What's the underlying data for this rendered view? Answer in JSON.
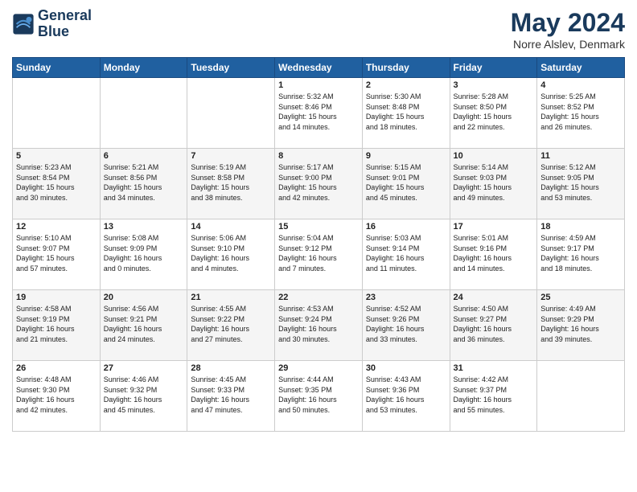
{
  "logo": {
    "line1": "General",
    "line2": "Blue"
  },
  "title": "May 2024",
  "subtitle": "Norre Alslev, Denmark",
  "weekdays": [
    "Sunday",
    "Monday",
    "Tuesday",
    "Wednesday",
    "Thursday",
    "Friday",
    "Saturday"
  ],
  "weeks": [
    [
      {
        "day": "",
        "info": ""
      },
      {
        "day": "",
        "info": ""
      },
      {
        "day": "",
        "info": ""
      },
      {
        "day": "1",
        "info": "Sunrise: 5:32 AM\nSunset: 8:46 PM\nDaylight: 15 hours\nand 14 minutes."
      },
      {
        "day": "2",
        "info": "Sunrise: 5:30 AM\nSunset: 8:48 PM\nDaylight: 15 hours\nand 18 minutes."
      },
      {
        "day": "3",
        "info": "Sunrise: 5:28 AM\nSunset: 8:50 PM\nDaylight: 15 hours\nand 22 minutes."
      },
      {
        "day": "4",
        "info": "Sunrise: 5:25 AM\nSunset: 8:52 PM\nDaylight: 15 hours\nand 26 minutes."
      }
    ],
    [
      {
        "day": "5",
        "info": "Sunrise: 5:23 AM\nSunset: 8:54 PM\nDaylight: 15 hours\nand 30 minutes."
      },
      {
        "day": "6",
        "info": "Sunrise: 5:21 AM\nSunset: 8:56 PM\nDaylight: 15 hours\nand 34 minutes."
      },
      {
        "day": "7",
        "info": "Sunrise: 5:19 AM\nSunset: 8:58 PM\nDaylight: 15 hours\nand 38 minutes."
      },
      {
        "day": "8",
        "info": "Sunrise: 5:17 AM\nSunset: 9:00 PM\nDaylight: 15 hours\nand 42 minutes."
      },
      {
        "day": "9",
        "info": "Sunrise: 5:15 AM\nSunset: 9:01 PM\nDaylight: 15 hours\nand 45 minutes."
      },
      {
        "day": "10",
        "info": "Sunrise: 5:14 AM\nSunset: 9:03 PM\nDaylight: 15 hours\nand 49 minutes."
      },
      {
        "day": "11",
        "info": "Sunrise: 5:12 AM\nSunset: 9:05 PM\nDaylight: 15 hours\nand 53 minutes."
      }
    ],
    [
      {
        "day": "12",
        "info": "Sunrise: 5:10 AM\nSunset: 9:07 PM\nDaylight: 15 hours\nand 57 minutes."
      },
      {
        "day": "13",
        "info": "Sunrise: 5:08 AM\nSunset: 9:09 PM\nDaylight: 16 hours\nand 0 minutes."
      },
      {
        "day": "14",
        "info": "Sunrise: 5:06 AM\nSunset: 9:10 PM\nDaylight: 16 hours\nand 4 minutes."
      },
      {
        "day": "15",
        "info": "Sunrise: 5:04 AM\nSunset: 9:12 PM\nDaylight: 16 hours\nand 7 minutes."
      },
      {
        "day": "16",
        "info": "Sunrise: 5:03 AM\nSunset: 9:14 PM\nDaylight: 16 hours\nand 11 minutes."
      },
      {
        "day": "17",
        "info": "Sunrise: 5:01 AM\nSunset: 9:16 PM\nDaylight: 16 hours\nand 14 minutes."
      },
      {
        "day": "18",
        "info": "Sunrise: 4:59 AM\nSunset: 9:17 PM\nDaylight: 16 hours\nand 18 minutes."
      }
    ],
    [
      {
        "day": "19",
        "info": "Sunrise: 4:58 AM\nSunset: 9:19 PM\nDaylight: 16 hours\nand 21 minutes."
      },
      {
        "day": "20",
        "info": "Sunrise: 4:56 AM\nSunset: 9:21 PM\nDaylight: 16 hours\nand 24 minutes."
      },
      {
        "day": "21",
        "info": "Sunrise: 4:55 AM\nSunset: 9:22 PM\nDaylight: 16 hours\nand 27 minutes."
      },
      {
        "day": "22",
        "info": "Sunrise: 4:53 AM\nSunset: 9:24 PM\nDaylight: 16 hours\nand 30 minutes."
      },
      {
        "day": "23",
        "info": "Sunrise: 4:52 AM\nSunset: 9:26 PM\nDaylight: 16 hours\nand 33 minutes."
      },
      {
        "day": "24",
        "info": "Sunrise: 4:50 AM\nSunset: 9:27 PM\nDaylight: 16 hours\nand 36 minutes."
      },
      {
        "day": "25",
        "info": "Sunrise: 4:49 AM\nSunset: 9:29 PM\nDaylight: 16 hours\nand 39 minutes."
      }
    ],
    [
      {
        "day": "26",
        "info": "Sunrise: 4:48 AM\nSunset: 9:30 PM\nDaylight: 16 hours\nand 42 minutes."
      },
      {
        "day": "27",
        "info": "Sunrise: 4:46 AM\nSunset: 9:32 PM\nDaylight: 16 hours\nand 45 minutes."
      },
      {
        "day": "28",
        "info": "Sunrise: 4:45 AM\nSunset: 9:33 PM\nDaylight: 16 hours\nand 47 minutes."
      },
      {
        "day": "29",
        "info": "Sunrise: 4:44 AM\nSunset: 9:35 PM\nDaylight: 16 hours\nand 50 minutes."
      },
      {
        "day": "30",
        "info": "Sunrise: 4:43 AM\nSunset: 9:36 PM\nDaylight: 16 hours\nand 53 minutes."
      },
      {
        "day": "31",
        "info": "Sunrise: 4:42 AM\nSunset: 9:37 PM\nDaylight: 16 hours\nand 55 minutes."
      },
      {
        "day": "",
        "info": ""
      }
    ]
  ]
}
